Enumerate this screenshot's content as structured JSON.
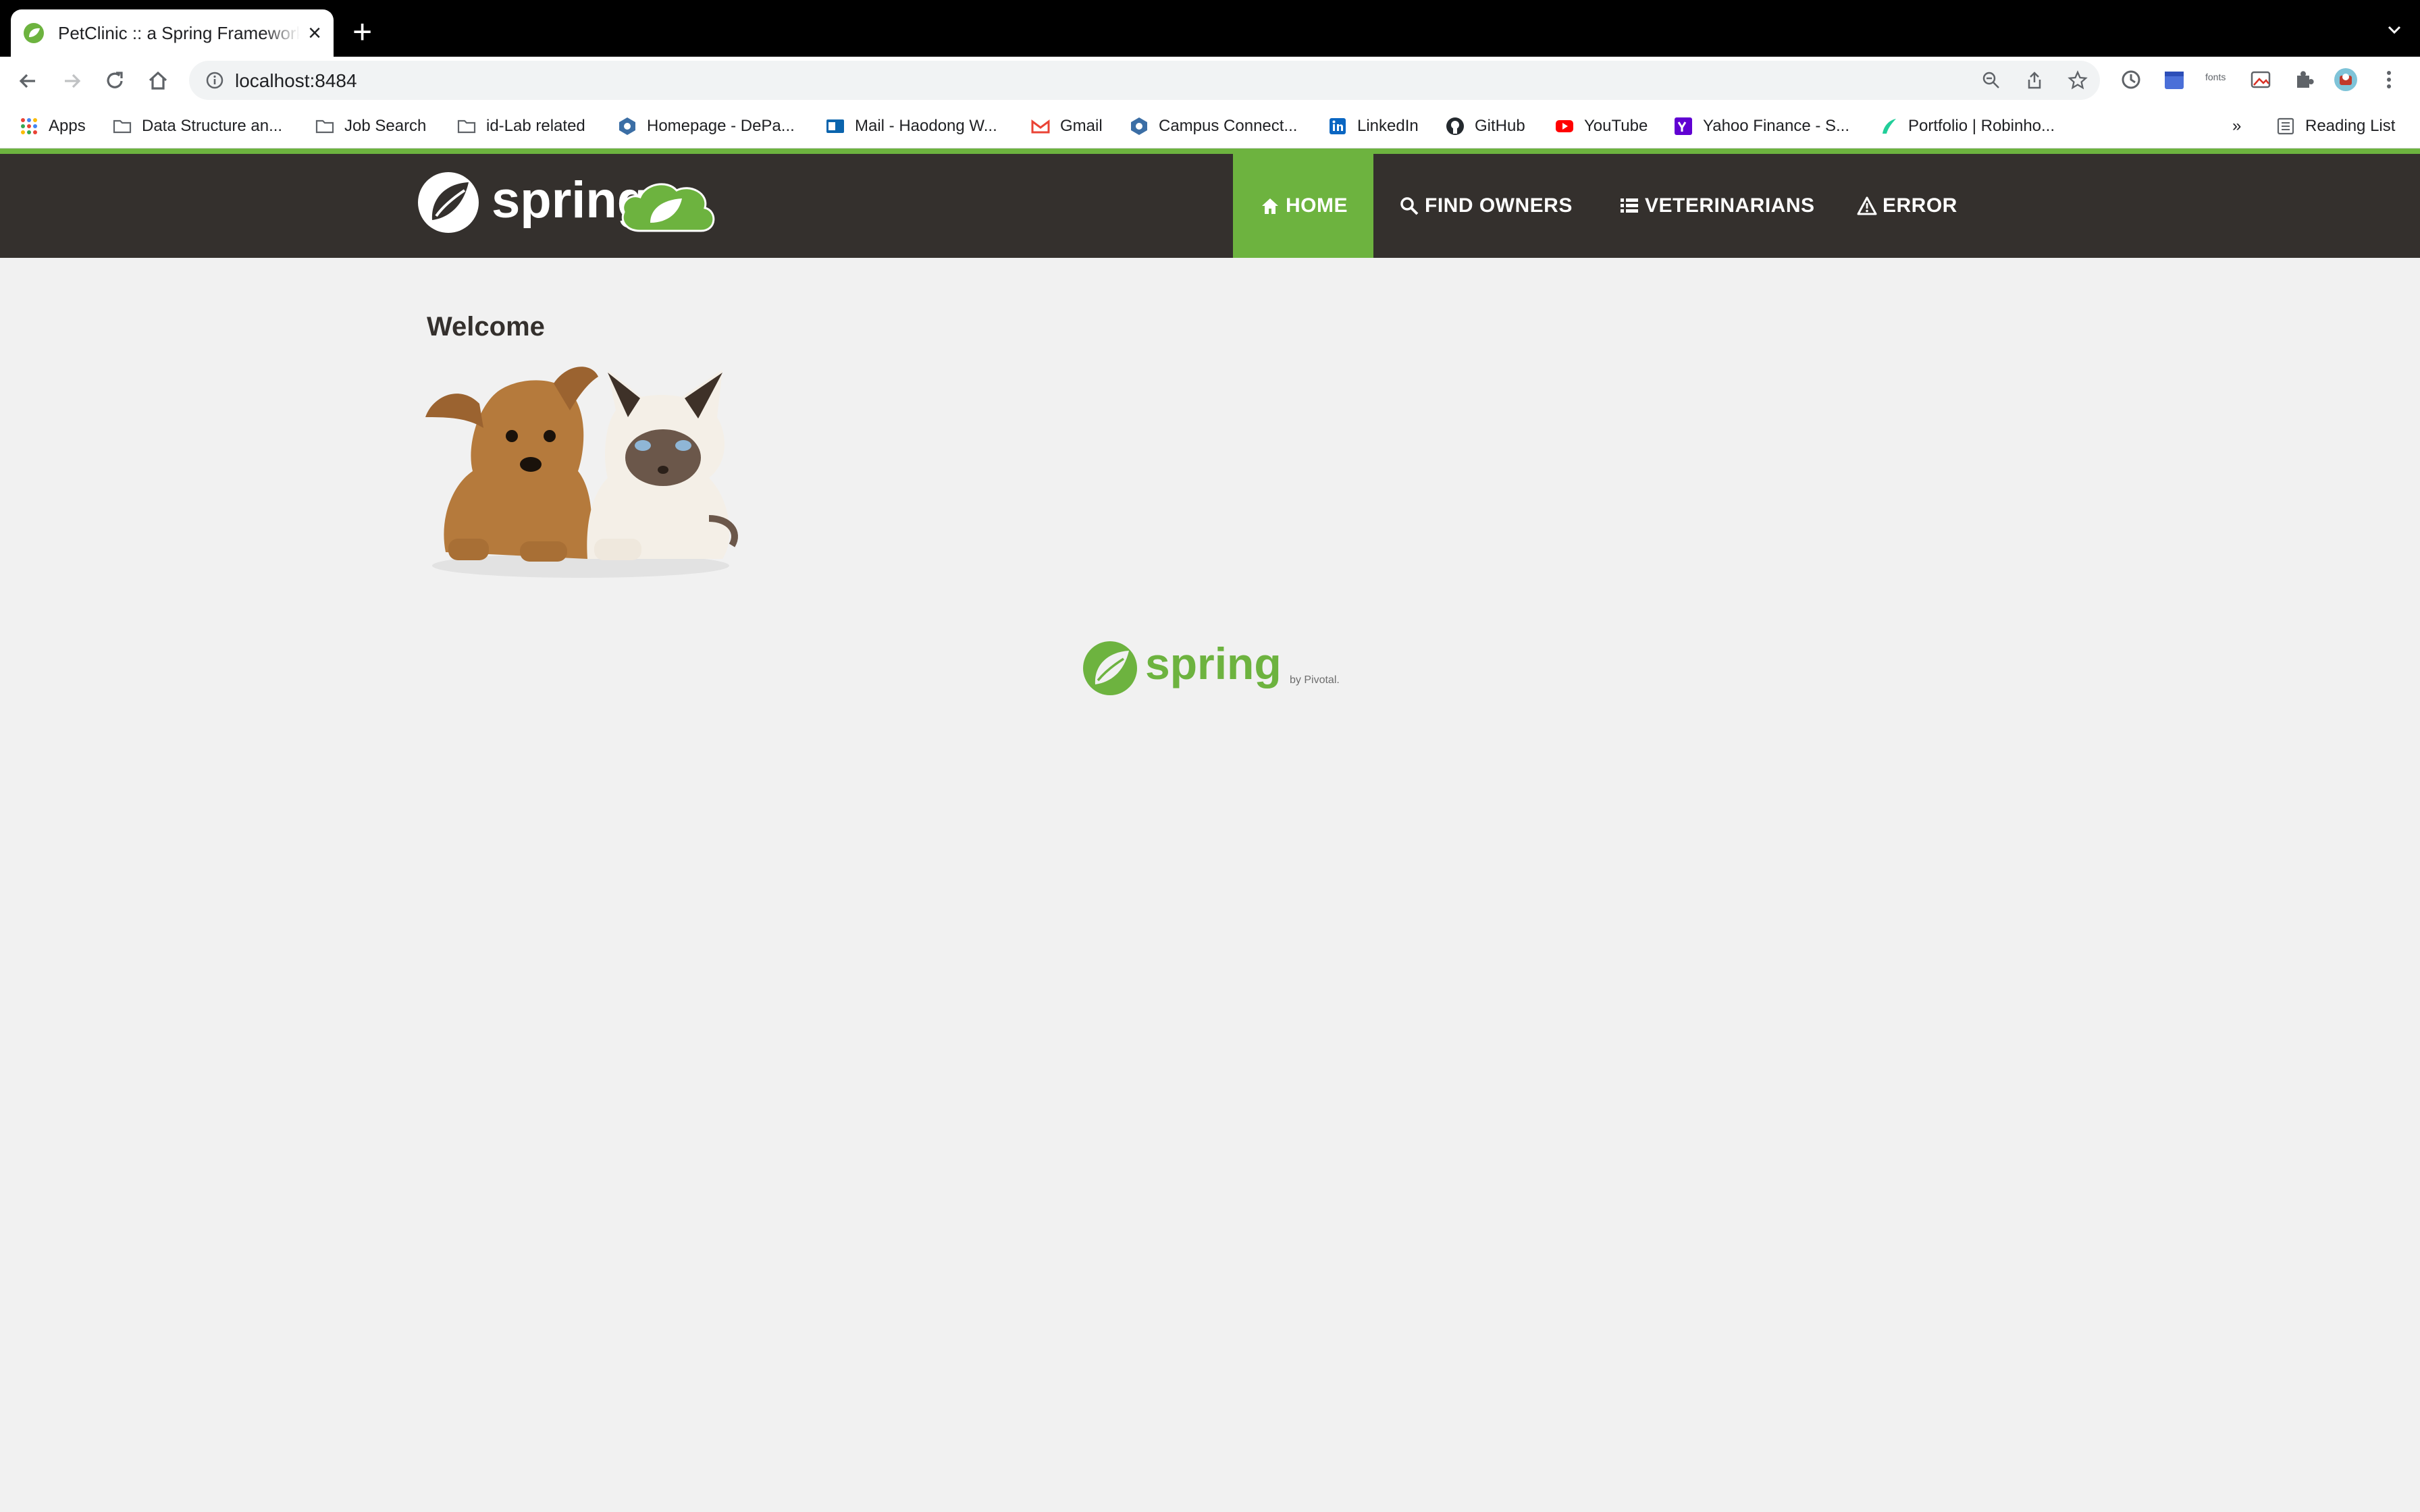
{
  "browser": {
    "tab_title": "PetClinic :: a Spring Framework demonstration",
    "url": "localhost:8484",
    "bookmarks": [
      {
        "label": "Apps",
        "icon": "apps-grid-icon"
      },
      {
        "label": "Data Structure an...",
        "icon": "folder-icon"
      },
      {
        "label": "Job Search",
        "icon": "folder-icon"
      },
      {
        "label": "id-Lab related",
        "icon": "folder-icon"
      },
      {
        "label": "Homepage - DePa...",
        "icon": "depaul-icon"
      },
      {
        "label": "Mail - Haodong W...",
        "icon": "outlook-icon"
      },
      {
        "label": "Gmail",
        "icon": "gmail-icon"
      },
      {
        "label": "Campus Connect...",
        "icon": "depaul-icon"
      },
      {
        "label": "LinkedIn",
        "icon": "linkedin-icon"
      },
      {
        "label": "GitHub",
        "icon": "github-icon"
      },
      {
        "label": "YouTube",
        "icon": "youtube-icon"
      },
      {
        "label": "Yahoo Finance - S...",
        "icon": "yahoo-icon"
      },
      {
        "label": "Portfolio | Robinho...",
        "icon": "robinhood-icon"
      }
    ],
    "overflow": "»",
    "reading_list": "Reading List",
    "fonts_ext": "fonts"
  },
  "nav": {
    "items": [
      {
        "label": "HOME",
        "icon": "home-icon",
        "active": true
      },
      {
        "label": "FIND OWNERS",
        "icon": "search-icon",
        "active": false
      },
      {
        "label": "VETERINARIANS",
        "icon": "list-icon",
        "active": false
      },
      {
        "label": "ERROR",
        "icon": "warning-icon",
        "active": false
      }
    ]
  },
  "main": {
    "heading": "Welcome"
  },
  "logo": {
    "wordmark": "spring",
    "footer_wordmark": "spring",
    "footer_tagline": "by Pivotal."
  },
  "colors": {
    "brand_green": "#6db33f",
    "navbar_bg": "#34302d",
    "page_bg": "#f1f1f1"
  }
}
